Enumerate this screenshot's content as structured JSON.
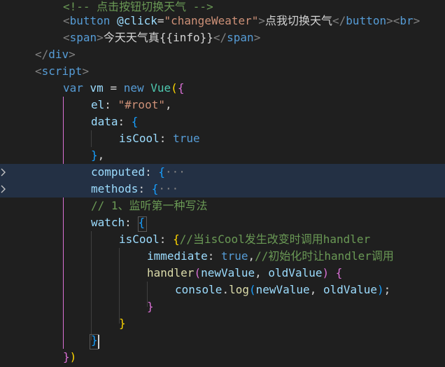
{
  "editor": {
    "lines": [
      {
        "id": "l01",
        "tokens": [
          {
            "t": "<!-- 点击按钮切换天气 -->",
            "c": "c-comment"
          }
        ]
      },
      {
        "id": "l02",
        "tokens": [
          {
            "t": "<",
            "c": "c-punc"
          },
          {
            "t": "button",
            "c": "c-tag"
          },
          {
            "t": " ",
            "c": "c-text"
          },
          {
            "t": "@click",
            "c": "c-attr"
          },
          {
            "t": "=",
            "c": "c-text"
          },
          {
            "t": "\"changeWeater\"",
            "c": "c-str"
          },
          {
            "t": ">",
            "c": "c-punc"
          },
          {
            "t": "点我切换天气",
            "c": "c-text"
          },
          {
            "t": "</",
            "c": "c-punc"
          },
          {
            "t": "button",
            "c": "c-tag"
          },
          {
            "t": ">",
            "c": "c-punc"
          },
          {
            "t": "<",
            "c": "c-punc"
          },
          {
            "t": "br",
            "c": "c-tag"
          },
          {
            "t": ">",
            "c": "c-punc"
          }
        ]
      },
      {
        "id": "l03",
        "tokens": [
          {
            "t": "<",
            "c": "c-punc"
          },
          {
            "t": "span",
            "c": "c-tag"
          },
          {
            "t": ">",
            "c": "c-punc"
          },
          {
            "t": "今天天气真{{info}}",
            "c": "c-text"
          },
          {
            "t": "</",
            "c": "c-punc"
          },
          {
            "t": "span",
            "c": "c-tag"
          },
          {
            "t": ">",
            "c": "c-punc"
          }
        ]
      },
      {
        "id": "l04",
        "tokens": [
          {
            "t": "</",
            "c": "c-punc"
          },
          {
            "t": "div",
            "c": "c-tag"
          },
          {
            "t": ">",
            "c": "c-punc"
          }
        ]
      },
      {
        "id": "l05",
        "tokens": [
          {
            "t": "<",
            "c": "c-punc"
          },
          {
            "t": "script",
            "c": "c-tag"
          },
          {
            "t": ">",
            "c": "c-punc"
          }
        ]
      },
      {
        "id": "l06",
        "tokens": [
          {
            "t": "var",
            "c": "c-kw"
          },
          {
            "t": " ",
            "c": "c-text"
          },
          {
            "t": "vm",
            "c": "c-var"
          },
          {
            "t": " = ",
            "c": "c-text"
          },
          {
            "t": "new",
            "c": "c-kw"
          },
          {
            "t": " ",
            "c": "c-text"
          },
          {
            "t": "Vue",
            "c": "c-type"
          },
          {
            "t": "(",
            "c": "c-br1"
          },
          {
            "t": "{",
            "c": "c-br2"
          }
        ]
      },
      {
        "id": "l07",
        "tokens": [
          {
            "t": "el",
            "c": "c-var"
          },
          {
            "t": ": ",
            "c": "c-text"
          },
          {
            "t": "\"#root\"",
            "c": "c-str"
          },
          {
            "t": ",",
            "c": "c-text"
          }
        ]
      },
      {
        "id": "l08",
        "tokens": [
          {
            "t": "data",
            "c": "c-var"
          },
          {
            "t": ": ",
            "c": "c-text"
          },
          {
            "t": "{",
            "c": "c-br3"
          }
        ]
      },
      {
        "id": "l09",
        "tokens": [
          {
            "t": "isCool",
            "c": "c-var"
          },
          {
            "t": ": ",
            "c": "c-text"
          },
          {
            "t": "true",
            "c": "c-kw"
          }
        ]
      },
      {
        "id": "l10",
        "tokens": [
          {
            "t": "}",
            "c": "c-br3"
          },
          {
            "t": ",",
            "c": "c-text"
          }
        ]
      },
      {
        "id": "l11",
        "tokens": [
          {
            "t": "computed",
            "c": "c-var"
          },
          {
            "t": ": ",
            "c": "c-text"
          },
          {
            "t": "{",
            "c": "c-br3"
          },
          {
            "t": "···",
            "c": "c-punc"
          }
        ]
      },
      {
        "id": "l12",
        "tokens": [
          {
            "t": "methods",
            "c": "c-var"
          },
          {
            "t": ": ",
            "c": "c-text"
          },
          {
            "t": "{",
            "c": "c-br3"
          },
          {
            "t": "···",
            "c": "c-punc"
          }
        ]
      },
      {
        "id": "l13",
        "tokens": [
          {
            "t": "// 1、监听第一种写法",
            "c": "c-comment"
          }
        ]
      },
      {
        "id": "l14",
        "tokens": [
          {
            "t": "watch",
            "c": "c-var"
          },
          {
            "t": ": ",
            "c": "c-text"
          },
          {
            "t": "{",
            "c": "c-br3"
          }
        ]
      },
      {
        "id": "l15",
        "tokens": [
          {
            "t": "isCool",
            "c": "c-var"
          },
          {
            "t": ": ",
            "c": "c-text"
          },
          {
            "t": "{",
            "c": "c-br1"
          },
          {
            "t": "//当isCool发生改变时调用handler",
            "c": "c-comment"
          }
        ]
      },
      {
        "id": "l16",
        "tokens": [
          {
            "t": "immediate",
            "c": "c-var"
          },
          {
            "t": ": ",
            "c": "c-text"
          },
          {
            "t": "true",
            "c": "c-kw"
          },
          {
            "t": ",",
            "c": "c-text"
          },
          {
            "t": "//初始化时让handler调用",
            "c": "c-comment"
          }
        ]
      },
      {
        "id": "l17",
        "tokens": [
          {
            "t": "handler",
            "c": "c-fn"
          },
          {
            "t": "(",
            "c": "c-br2"
          },
          {
            "t": "newValue",
            "c": "c-var"
          },
          {
            "t": ", ",
            "c": "c-text"
          },
          {
            "t": "oldValue",
            "c": "c-var"
          },
          {
            "t": ")",
            "c": "c-br2"
          },
          {
            "t": " ",
            "c": "c-text"
          },
          {
            "t": "{",
            "c": "c-br2"
          }
        ]
      },
      {
        "id": "l18",
        "tokens": [
          {
            "t": "console",
            "c": "c-var"
          },
          {
            "t": ".",
            "c": "c-text"
          },
          {
            "t": "log",
            "c": "c-fn"
          },
          {
            "t": "(",
            "c": "c-br3"
          },
          {
            "t": "newValue",
            "c": "c-var"
          },
          {
            "t": ", ",
            "c": "c-text"
          },
          {
            "t": "oldValue",
            "c": "c-var"
          },
          {
            "t": ")",
            "c": "c-br3"
          },
          {
            "t": ";",
            "c": "c-text"
          }
        ]
      },
      {
        "id": "l19",
        "tokens": [
          {
            "t": "}",
            "c": "c-br2"
          }
        ]
      },
      {
        "id": "l20",
        "tokens": [
          {
            "t": "}",
            "c": "c-br1"
          }
        ]
      },
      {
        "id": "l21",
        "tokens": [
          {
            "t": "}",
            "c": "c-br3"
          }
        ]
      },
      {
        "id": "l22",
        "tokens": [
          {
            "t": "}",
            "c": "c-br2"
          },
          {
            "t": ")",
            "c": "c-br1"
          }
        ]
      }
    ],
    "folded_marker": "···",
    "fold_icon": "chevron-right-icon",
    "colors": {
      "background": "#1f1f1f",
      "highlight_line": "#233044",
      "comment": "#6a9955",
      "keyword": "#569cd6",
      "string": "#ce9178",
      "variable": "#9cdcfe",
      "function": "#dcdcaa",
      "type": "#4ec9b0",
      "bracket_1": "#ffd700",
      "bracket_2": "#da70d6",
      "bracket_3": "#179fff"
    }
  }
}
